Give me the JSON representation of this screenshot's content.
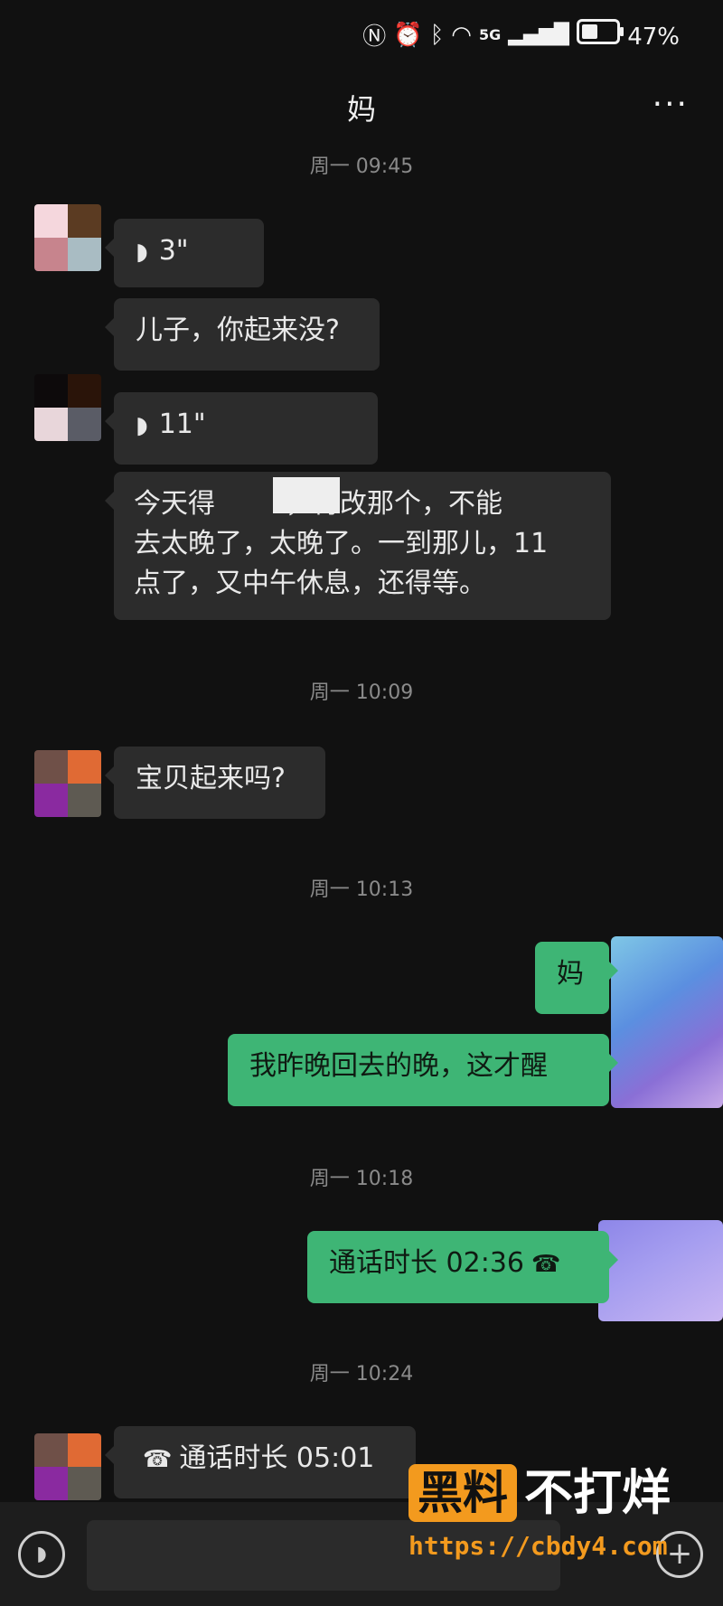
{
  "status_bar": {
    "icons": [
      "nfc-icon",
      "alarm-icon",
      "bluetooth-icon",
      "wifi-icon",
      "signal-5g-icon",
      "battery-icon"
    ],
    "signal_label": "5G",
    "battery_percent": "47%"
  },
  "header": {
    "title": "妈",
    "more_label": "···"
  },
  "timestamps": [
    "周一 09:45",
    "周一 10:09",
    "周一 10:13",
    "周一 10:18",
    "周一 10:24"
  ],
  "messages": [
    {
      "side": "in",
      "kind": "voice",
      "text": "3\""
    },
    {
      "side": "in",
      "kind": "text",
      "text": "儿子，你起来没?"
    },
    {
      "side": "in",
      "kind": "voice",
      "text": "11\""
    },
    {
      "side": "in",
      "kind": "text",
      "line1": "今天得",
      "line1b": "，得改那个，不能",
      "line2": "去太晚了，太晚了。一到那儿，11",
      "line3": "点了，又中午休息，还得等。"
    },
    {
      "side": "in",
      "kind": "text",
      "text": "宝贝起来吗?"
    },
    {
      "side": "out",
      "kind": "text",
      "text": "妈"
    },
    {
      "side": "out",
      "kind": "text",
      "text": "我昨晚回去的晚，这才醒"
    },
    {
      "side": "out",
      "kind": "call",
      "text": "通话时长 02:36"
    },
    {
      "side": "in",
      "kind": "call",
      "text": "通话时长 05:01"
    }
  ],
  "watermark": {
    "box_text": "黑料",
    "text": "不打烊",
    "url": "https://cbdy4.com"
  },
  "colors": {
    "background": "#111111",
    "incoming_bubble": "#2c2c2c",
    "outgoing_bubble": "#3eb575",
    "watermark_accent": "#f39a1e"
  }
}
